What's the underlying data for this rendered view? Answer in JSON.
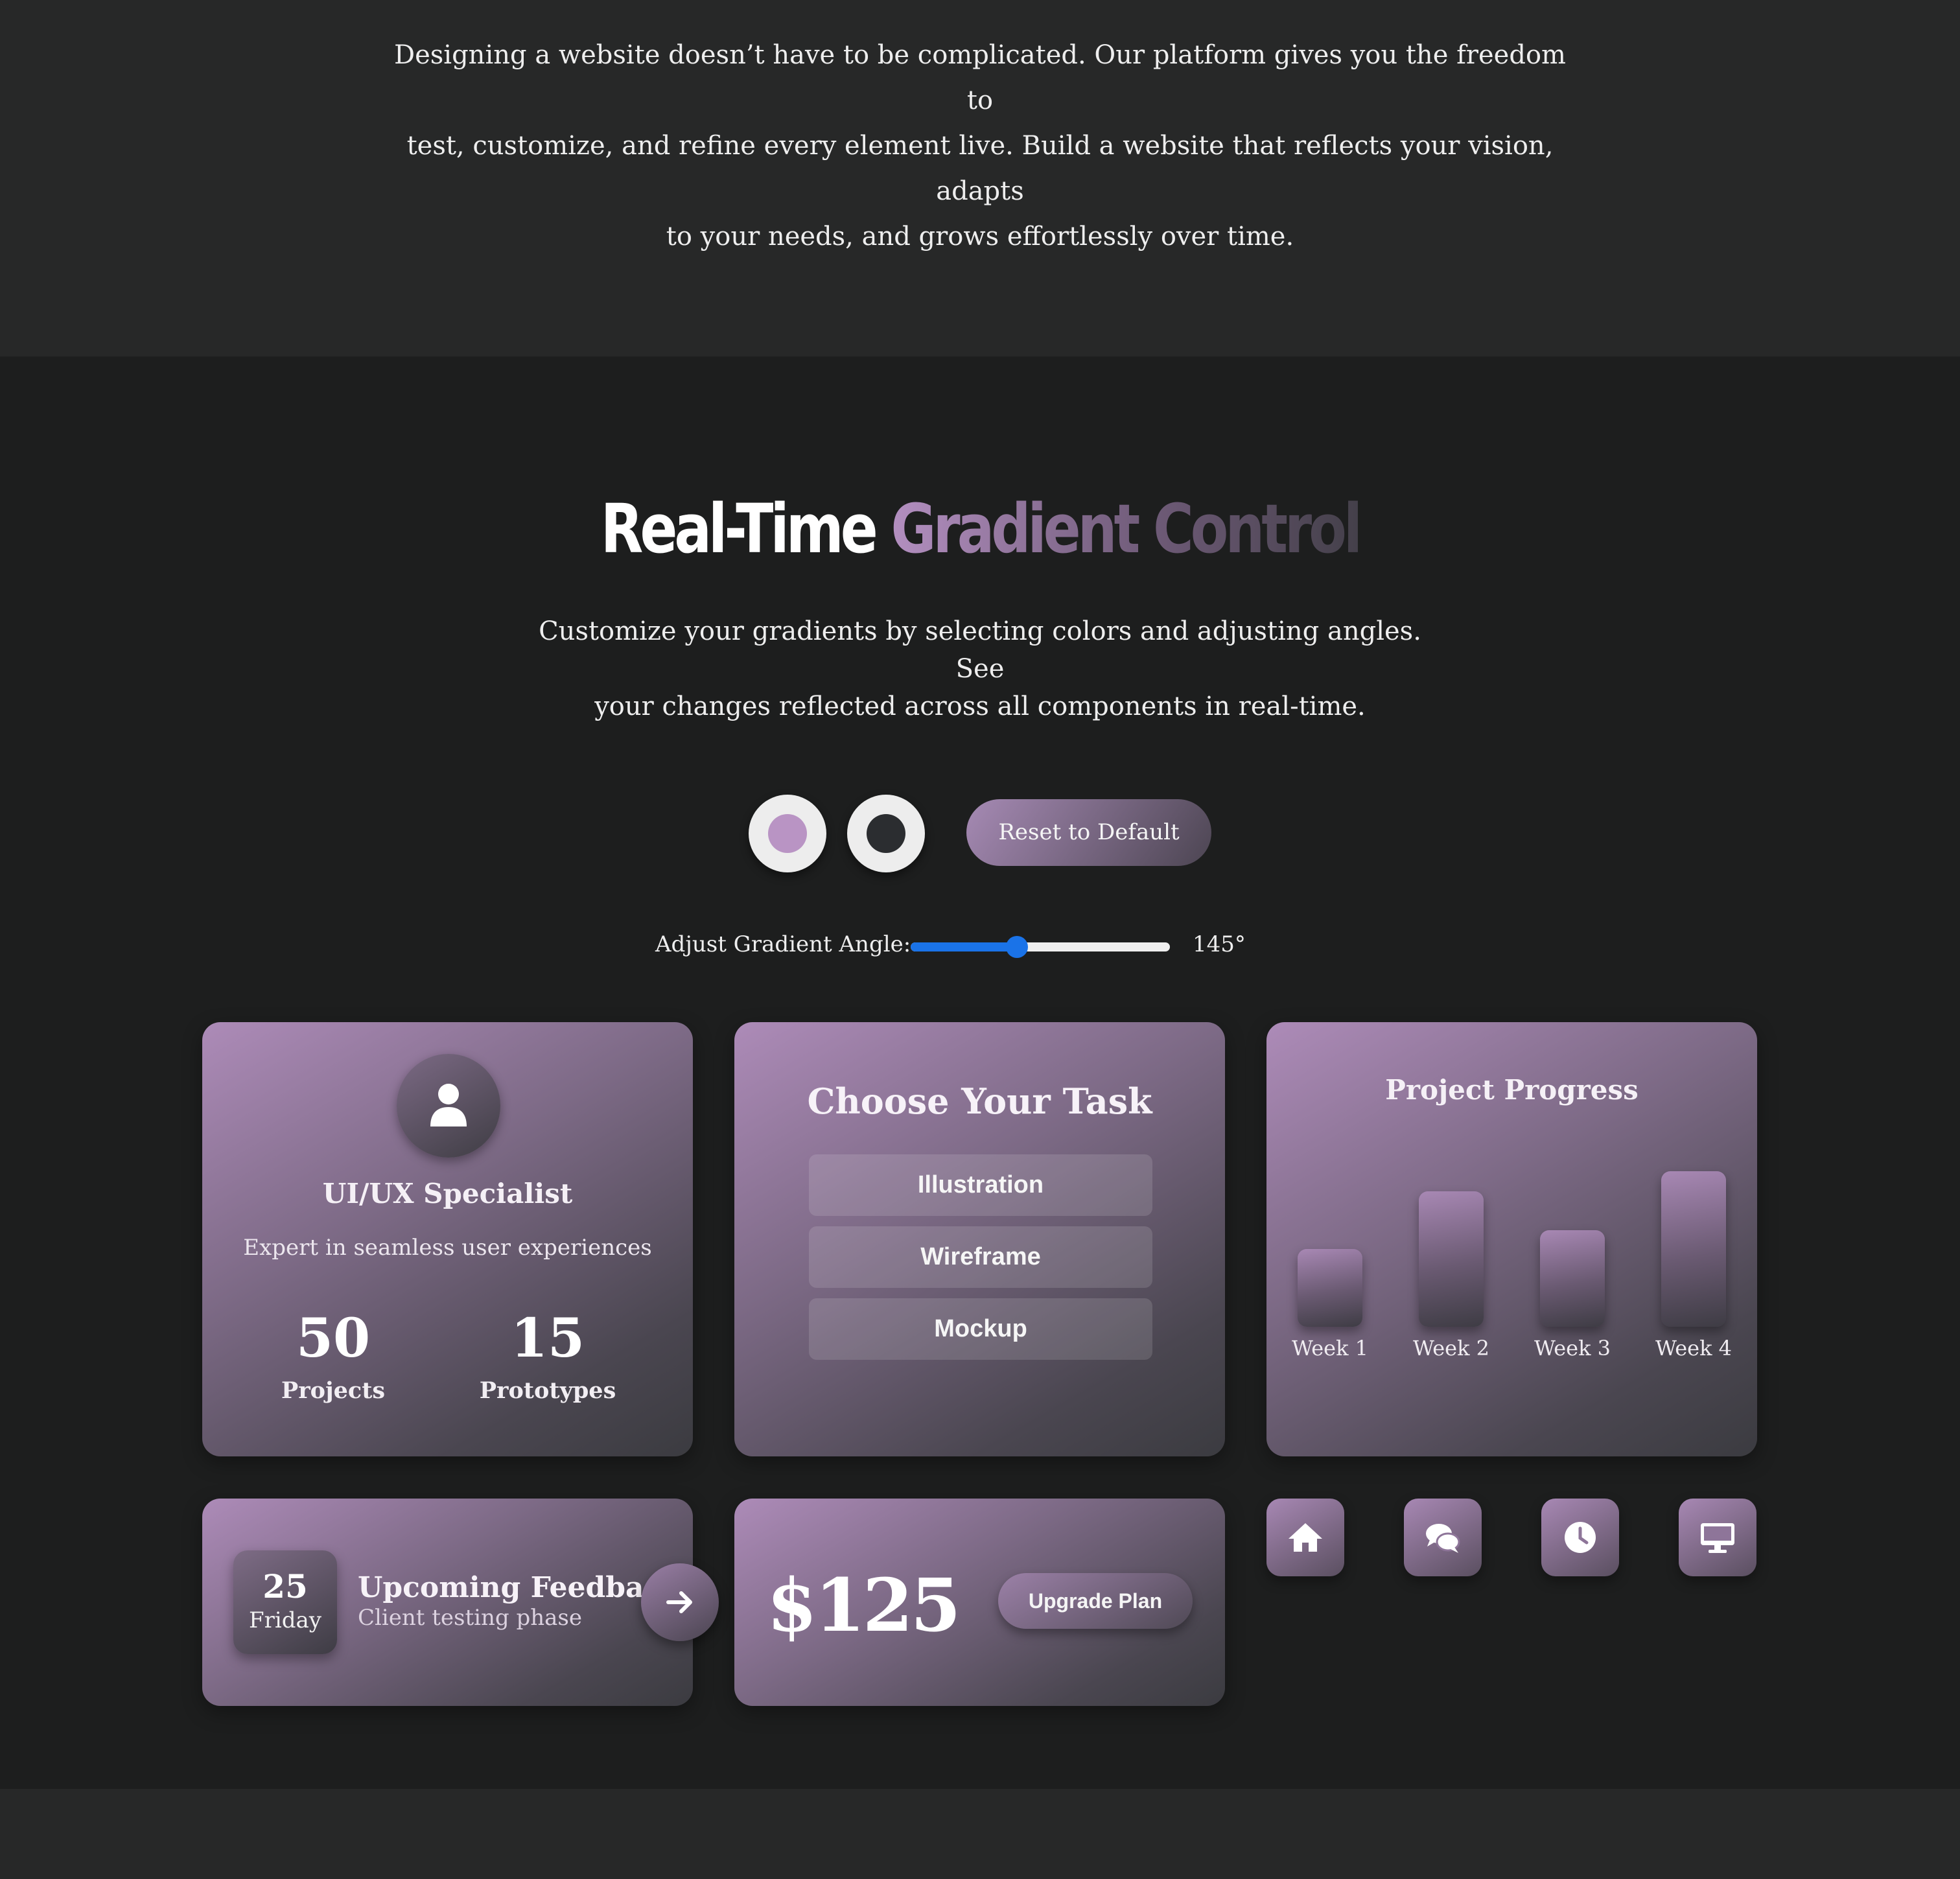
{
  "intro": {
    "line1": "Designing a website doesn’t have to be complicated. Our platform gives you the freedom to",
    "line2": "test, customize, and refine every element live. Build a website that reflects your vision, adapts",
    "line3": "to your needs, and grows effortlessly over time."
  },
  "hero": {
    "title_plain": "Real-Time",
    "title_gradient": "Gradient Control",
    "subtitle_line1": "Customize your gradients by selecting colors and adjusting angles. See",
    "subtitle_line2": "your changes reflected across all components in real-time."
  },
  "controls": {
    "color1": "#b994c4",
    "color2": "#2b2d30",
    "reset_label": "Reset to Default",
    "angle_label": "Adjust Gradient Angle:",
    "angle_value": "145°",
    "angle_fraction": 0.41
  },
  "profile_card": {
    "avatar_icon": "user-icon",
    "role": "UI/UX Specialist",
    "tagline": "Expert in seamless user experiences",
    "stats": [
      {
        "value": "50",
        "label": "Projects"
      },
      {
        "value": "15",
        "label": "Prototypes"
      }
    ]
  },
  "task_card": {
    "title": "Choose Your Task",
    "options": [
      "Illustration",
      "Wireframe",
      "Mockup"
    ]
  },
  "progress_card": {
    "title": "Project Progress",
    "weeks": [
      {
        "label": "Week 1",
        "level": 0.5
      },
      {
        "label": "Week 2",
        "level": 0.87
      },
      {
        "label": "Week 3",
        "level": 0.62
      },
      {
        "label": "Week 4",
        "level": 1.0
      }
    ]
  },
  "feedback_card": {
    "day": "25",
    "weekday": "Friday",
    "title": "Upcoming Feedback",
    "subtitle": "Client testing phase",
    "action_icon": "arrow-right-icon"
  },
  "pricing_card": {
    "price": "$125",
    "button_label": "Upgrade Plan"
  },
  "icon_buttons": [
    "home-icon",
    "chat-icon",
    "clock-icon",
    "desktop-icon"
  ]
}
